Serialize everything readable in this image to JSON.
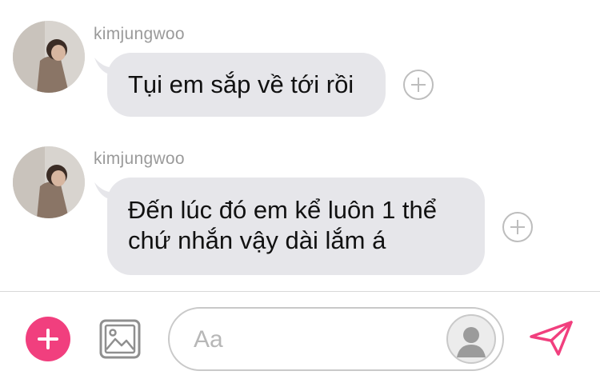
{
  "messages": [
    {
      "sender": "kimjungwoo",
      "lines": [
        "Tụi em sắp về tới rồi"
      ]
    },
    {
      "sender": "kimjungwoo",
      "lines": [
        "Đến lúc đó em kể luôn 1 thể",
        "chứ nhắn vậy dài lắm á"
      ]
    }
  ],
  "composer": {
    "placeholder": "Aa"
  },
  "icons": {
    "add": "plus-icon",
    "image": "image-icon",
    "send": "send-icon",
    "react": "add-reaction-icon",
    "profile": "profile-icon"
  },
  "colors": {
    "accent": "#f13f7e",
    "bubble": "#e6e6ea",
    "sender": "#9a9a9a"
  }
}
